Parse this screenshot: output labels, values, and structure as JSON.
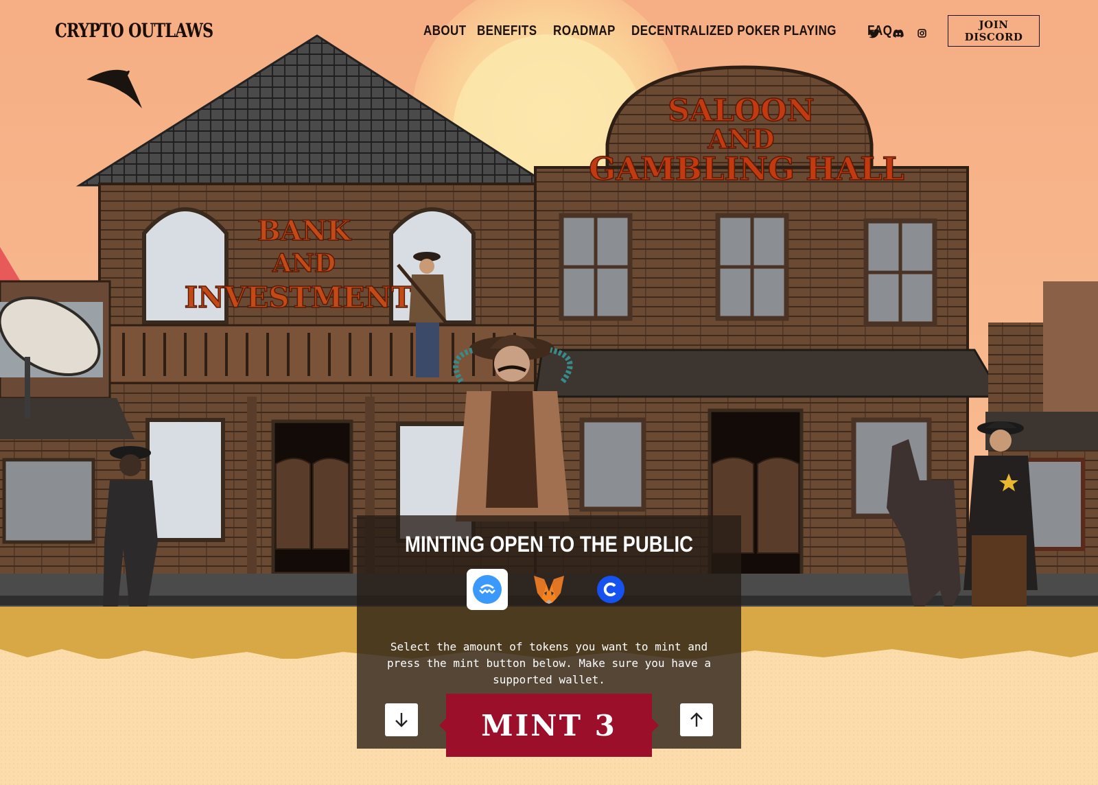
{
  "header": {
    "logo_text": "CRYPTO OUTLAWS",
    "nav": [
      "ABOUT",
      "BENEFITS",
      "ROADMAP",
      "DECENTRALIZED POKER PLAYING",
      "FAQ"
    ],
    "social": [
      "twitter-icon",
      "discord-icon",
      "instagram-icon"
    ],
    "discord_button": "JOIN DISCORD"
  },
  "scene": {
    "bank_sign": [
      "BANK",
      "AND",
      "INVESTMENTS"
    ],
    "saloon_sign": [
      "SALOON",
      "AND",
      "GAMBLING HALL"
    ]
  },
  "mint_panel": {
    "title": "MINTING OPEN TO THE PUBLIC",
    "wallets": [
      "walletconnect-icon",
      "metamask-icon",
      "coinbase-wallet-icon"
    ],
    "description": "Select the amount of tokens you want to mint and press the mint button below. Make sure you have a supported wallet.",
    "decrease_icon": "arrow-down-icon",
    "increase_icon": "arrow-up-icon",
    "mint_label": "MINT 3"
  },
  "colors": {
    "sky": "#f7b48a",
    "sun": "#fde4a0",
    "wood": "#6b4a34",
    "sand": "#fbdcaa",
    "mint_button": "#9c0f2b",
    "sign_text": "#c24a16"
  }
}
